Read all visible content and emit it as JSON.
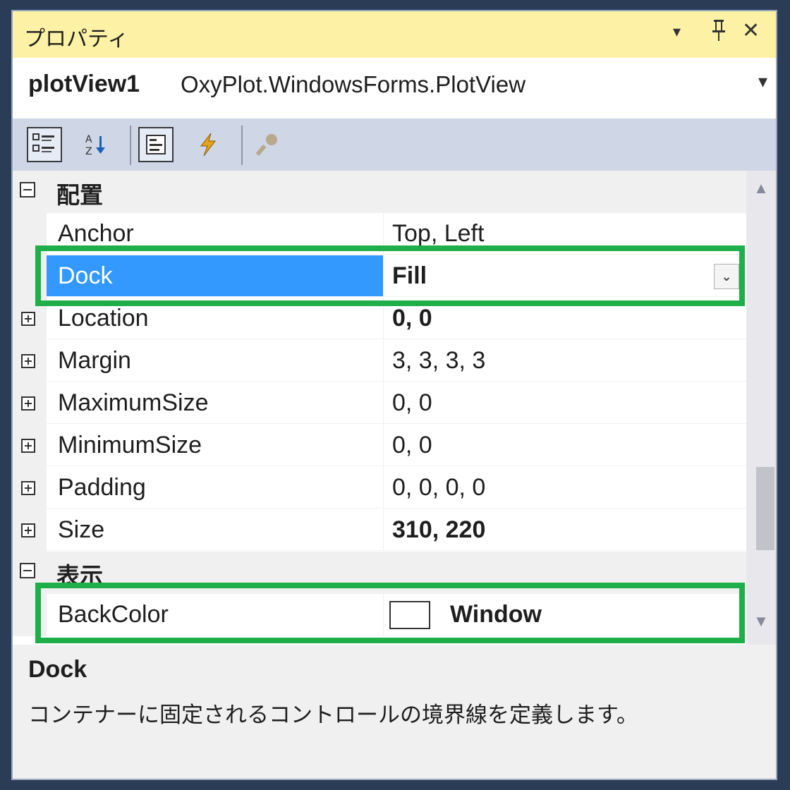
{
  "window": {
    "title": "プロパティ",
    "buttons": {
      "dropdown": "▾",
      "pin": "ᵽ",
      "close": "✕"
    }
  },
  "object_selector": {
    "name": "plotView1",
    "type": "OxyPlot.WindowsForms.PlotView",
    "dropdown": "▾"
  },
  "toolbar": {
    "items": [
      {
        "icon": "categorized-icon",
        "pressed": true
      },
      {
        "icon": "alphabetical-icon",
        "pressed": false
      },
      {
        "icon": "properties-icon",
        "pressed": true
      },
      {
        "icon": "events-icon",
        "pressed": false
      },
      {
        "icon": "property-pages-icon",
        "pressed": false
      }
    ]
  },
  "grid": {
    "categories": [
      {
        "label": "配置",
        "expanded": true
      },
      {
        "label": "表示",
        "expanded": true
      }
    ],
    "rows": [
      {
        "name": "Anchor",
        "value": "Top, Left",
        "bold": false,
        "expandable": false
      },
      {
        "name": "Dock",
        "value": "Fill",
        "bold": true,
        "expandable": false,
        "selected": true,
        "dropdown": "⌄"
      },
      {
        "name": "Location",
        "value": "0, 0",
        "bold": true,
        "expandable": true
      },
      {
        "name": "Margin",
        "value": "3, 3, 3, 3",
        "bold": false,
        "expandable": true
      },
      {
        "name": "MaximumSize",
        "value": "0, 0",
        "bold": false,
        "expandable": true
      },
      {
        "name": "MinimumSize",
        "value": "0, 0",
        "bold": false,
        "expandable": true
      },
      {
        "name": "Padding",
        "value": "0, 0, 0, 0",
        "bold": false,
        "expandable": true
      },
      {
        "name": "Size",
        "value": "310, 220",
        "bold": true,
        "expandable": true
      },
      {
        "name": "BackColor",
        "value": "Window",
        "bold": true,
        "expandable": false,
        "swatch_color": "#ffffff"
      }
    ]
  },
  "description": {
    "title": "Dock",
    "text": "コンテナーに固定されるコントロールの境界線を定義します。"
  },
  "colors": {
    "highlight": "#1fae4a",
    "selection": "#3399ff",
    "title_bar": "#fcf1a4",
    "toolbar": "#cfd6e5",
    "background": "#2b3c57"
  }
}
